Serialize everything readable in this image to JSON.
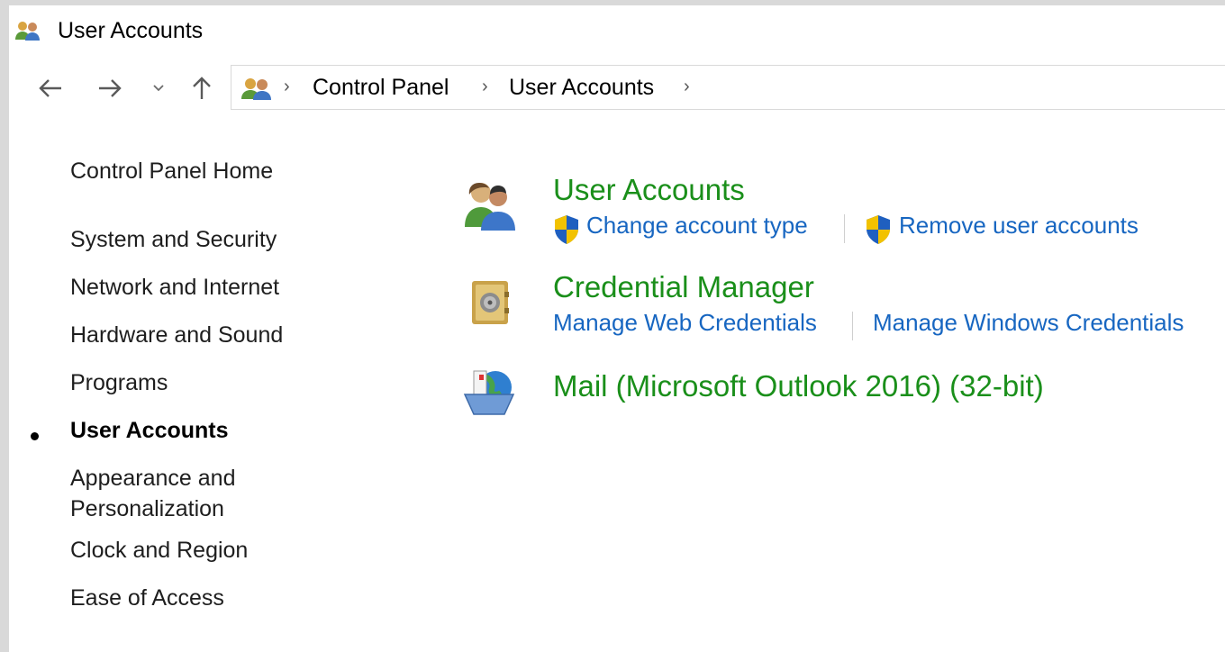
{
  "window": {
    "title": "User Accounts"
  },
  "address_bar": {
    "crumbs": [
      "Control Panel",
      "User Accounts"
    ]
  },
  "sidebar": {
    "home": "Control Panel Home",
    "items": [
      {
        "label": "System and Security"
      },
      {
        "label": "Network and Internet"
      },
      {
        "label": "Hardware and Sound"
      },
      {
        "label": "Programs"
      },
      {
        "label": "User Accounts",
        "current": true
      },
      {
        "label": "Appearance and",
        "label2": "Personalization"
      },
      {
        "label": "Clock and Region"
      },
      {
        "label": "Ease of Access"
      }
    ]
  },
  "categories": [
    {
      "title": "User Accounts",
      "icon": "users-icon",
      "tasks": [
        "Change account type",
        "Remove user accounts"
      ]
    },
    {
      "title": "Credential Manager",
      "icon": "vault-icon",
      "tasks": [
        "Manage Web Credentials",
        "Manage Windows Credentials"
      ]
    },
    {
      "title": "Mail (Microsoft Outlook 2016) (32-bit)",
      "icon": "mail-icon",
      "tasks": []
    }
  ],
  "colors": {
    "category_title": "#1a8f1a",
    "task_link": "#1766c1",
    "shield_blue": "#1f5fbf",
    "shield_yellow": "#f2c200"
  }
}
